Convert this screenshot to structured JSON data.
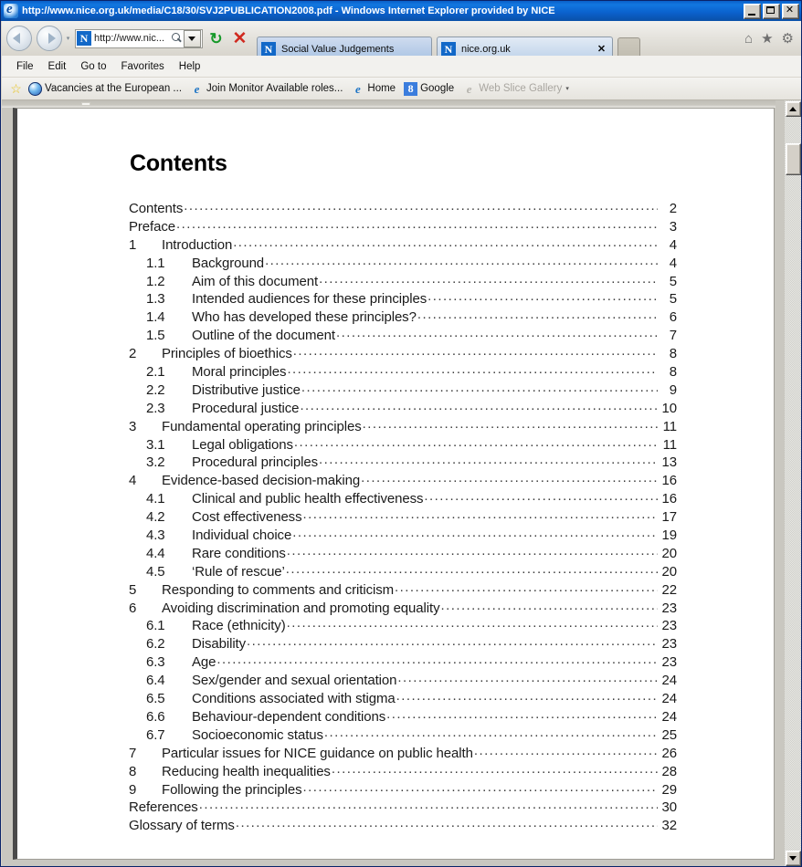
{
  "window": {
    "title": "http://www.nice.org.uk/media/C18/30/SVJ2PUBLICATION2008.pdf - Windows Internet Explorer provided by NICE",
    "app_icon": "internet-explorer-icon",
    "controls": {
      "minimize": "–",
      "maximize": "□",
      "close": "✕"
    }
  },
  "toolbar": {
    "back_label": "Back",
    "forward_label": "Forward",
    "recent_pages_caret": "▾",
    "address": {
      "favicon_letter": "N",
      "value": "http://www.nic...",
      "search_icon": "search-icon",
      "dropdown_icon": "chevron-down-icon"
    },
    "refresh_icon": "↻",
    "refresh_glyph": "⮂",
    "stop_icon": "✕",
    "home_icon": "⌂",
    "favorites_icon": "★",
    "settings_icon": "⚙"
  },
  "tabs": [
    {
      "favicon_letter": "N",
      "label": "Social Value Judgements",
      "active": true,
      "close": ""
    },
    {
      "favicon_letter": "N",
      "label": "nice.org.uk",
      "active": false,
      "close": "✕"
    }
  ],
  "new_tab_label": "",
  "menubar": {
    "items": [
      "File",
      "Edit",
      "Go to",
      "Favorites",
      "Help"
    ]
  },
  "favoritesbar": {
    "add_icon": "☆",
    "items": [
      {
        "icon": "globe-icon",
        "label": "Vacancies at the European ...",
        "dim": false
      },
      {
        "icon": "ie-page-icon",
        "label": "Join Monitor  Available roles...",
        "dim": false
      },
      {
        "icon": "ie-page-icon",
        "label": "Home",
        "dim": false
      },
      {
        "icon": "google-icon",
        "label": "Google",
        "dim": false
      },
      {
        "icon": "ie-page-icon",
        "label": "Web Slice Gallery",
        "dim": true,
        "caret": "▾"
      }
    ]
  },
  "document": {
    "heading": "Contents",
    "entries": [
      {
        "level": 0,
        "number": "",
        "title": "Contents",
        "page": "2"
      },
      {
        "level": 0,
        "number": "",
        "title": "Preface",
        "page": "3"
      },
      {
        "level": 1,
        "number": "1",
        "title": "Introduction",
        "page": "4"
      },
      {
        "level": 2,
        "number": "1.1",
        "title": "Background",
        "page": "4"
      },
      {
        "level": 2,
        "number": "1.2",
        "title": "Aim of this document",
        "page": "5"
      },
      {
        "level": 2,
        "number": "1.3",
        "title": "Intended audiences for these principles",
        "page": "5"
      },
      {
        "level": 2,
        "number": "1.4",
        "title": "Who has developed these principles?",
        "page": "6"
      },
      {
        "level": 2,
        "number": "1.5",
        "title": "Outline of the document",
        "page": "7"
      },
      {
        "level": 1,
        "number": "2",
        "title": "Principles of bioethics",
        "page": "8"
      },
      {
        "level": 2,
        "number": "2.1",
        "title": "Moral principles",
        "page": "8"
      },
      {
        "level": 2,
        "number": "2.2",
        "title": "Distributive justice",
        "page": "9"
      },
      {
        "level": 2,
        "number": "2.3",
        "title": "Procedural justice",
        "page": "10"
      },
      {
        "level": 1,
        "number": "3",
        "title": "Fundamental operating principles",
        "page": "11"
      },
      {
        "level": 2,
        "number": "3.1",
        "title": "Legal obligations",
        "page": "11"
      },
      {
        "level": 2,
        "number": "3.2",
        "title": "Procedural principles",
        "page": "13"
      },
      {
        "level": 1,
        "number": "4",
        "title": "Evidence-based decision-making",
        "page": "16"
      },
      {
        "level": 2,
        "number": "4.1",
        "title": "Clinical and public health effectiveness",
        "page": "16"
      },
      {
        "level": 2,
        "number": "4.2",
        "title": "Cost effectiveness",
        "page": "17"
      },
      {
        "level": 2,
        "number": "4.3",
        "title": "Individual choice",
        "page": "19"
      },
      {
        "level": 2,
        "number": "4.4",
        "title": "Rare conditions",
        "page": "20"
      },
      {
        "level": 2,
        "number": "4.5",
        "title": "‘Rule of rescue’",
        "page": "20"
      },
      {
        "level": 1,
        "number": "5",
        "title": "Responding to comments and criticism",
        "page": "22"
      },
      {
        "level": 1,
        "number": "6",
        "title": "Avoiding discrimination and promoting equality",
        "page": "23"
      },
      {
        "level": 2,
        "number": "6.1",
        "title": "Race (ethnicity)",
        "page": "23"
      },
      {
        "level": 2,
        "number": "6.2",
        "title": "Disability",
        "page": "23"
      },
      {
        "level": 2,
        "number": "6.3",
        "title": "Age",
        "page": "23"
      },
      {
        "level": 2,
        "number": "6.4",
        "title": "Sex/gender and sexual orientation",
        "page": "24"
      },
      {
        "level": 2,
        "number": "6.5",
        "title": "Conditions associated with stigma",
        "page": "24"
      },
      {
        "level": 2,
        "number": "6.6",
        "title": "Behaviour-dependent conditions",
        "page": "24"
      },
      {
        "level": 2,
        "number": "6.7",
        "title": "Socioeconomic status",
        "page": "25"
      },
      {
        "level": 1,
        "number": "7",
        "title": "Particular issues for NICE guidance on public health",
        "page": "26"
      },
      {
        "level": 1,
        "number": "8",
        "title": "Reducing health inequalities",
        "page": "28"
      },
      {
        "level": 1,
        "number": "9",
        "title": "Following the principles",
        "page": "29"
      },
      {
        "level": 0,
        "number": "",
        "title": "References",
        "page": "30"
      },
      {
        "level": 0,
        "number": "",
        "title": "Glossary of terms",
        "page": "32"
      }
    ]
  },
  "scrollbar": {
    "up_arrow": "▲",
    "down_arrow": "▼"
  },
  "colors": {
    "titlebar_blue": "#0b63cf",
    "tab_active": "#b8cde8",
    "tab_inactive": "#ccdcee",
    "favicon_blue": "#1268c8",
    "chrome_grey": "#e4e2dc",
    "refresh_green": "#17992a",
    "stop_red": "#d02a20",
    "page_white": "#ffffff",
    "text_black": "#1a1a1a"
  }
}
